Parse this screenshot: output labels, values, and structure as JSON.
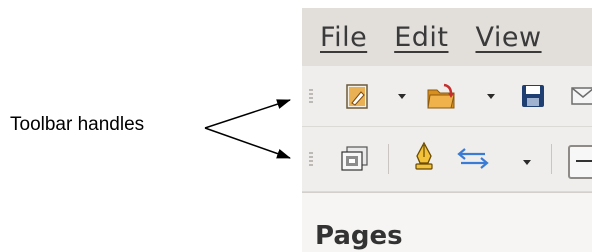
{
  "annotation": {
    "label": "Toolbar handles"
  },
  "menubar": {
    "items": [
      "File",
      "Edit",
      "View"
    ]
  },
  "toolbar_standard": {
    "icons": [
      "new-document-icon",
      "open-folder-icon",
      "save-icon",
      "email-icon"
    ]
  },
  "toolbar_drawing": {
    "icons": [
      "slide-layout-icon",
      "pen-icon",
      "arrows-icon",
      "line-style-icon"
    ]
  },
  "panel": {
    "title": "Pages"
  },
  "colors": {
    "menubar_bg": "#e2dfdb",
    "toolbar_bg": "#efeeec",
    "panel_bg": "#f6f5f4",
    "icon_orange": "#e8a53a",
    "icon_navy": "#1f3f72",
    "icon_blue": "#3a7bd5"
  }
}
